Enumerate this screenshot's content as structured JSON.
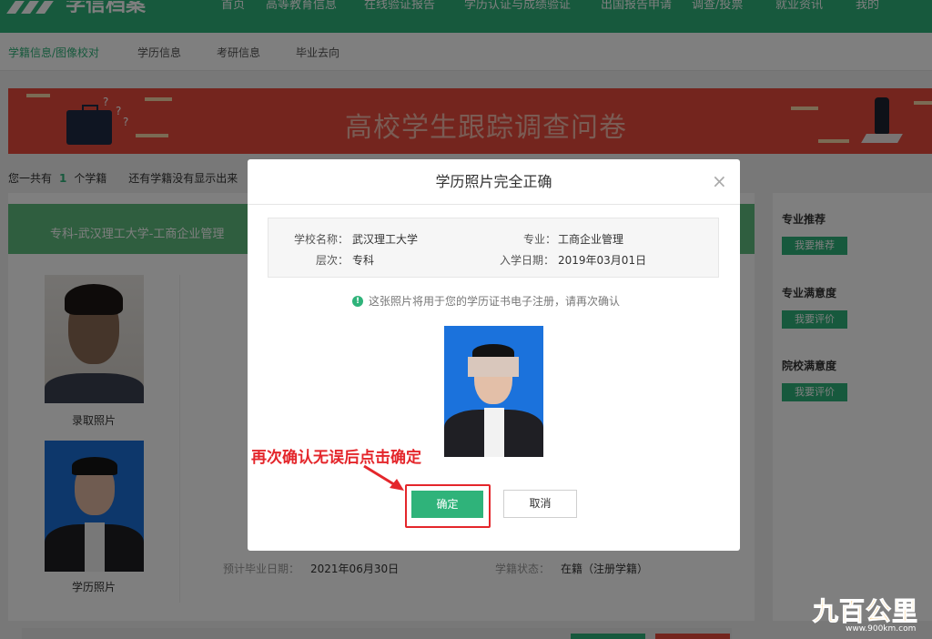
{
  "nav": {
    "logo_text": "学信档案",
    "items": [
      "首页",
      "高等教育信息",
      "在线验证报告",
      "学历认证与成绩验证",
      "出国报告申请",
      "调查/投票",
      "就业资讯",
      "我的"
    ]
  },
  "subnav": {
    "items": [
      "学籍信息/图像校对",
      "学历信息",
      "考研信息",
      "毕业去向"
    ]
  },
  "banner": {
    "title": "高校学生跟踪调查问卷"
  },
  "record": {
    "prefix": "您一共有",
    "count": "1",
    "suffix": "个学籍",
    "missing": "还有学籍没有显示出来"
  },
  "card": {
    "header": "专科-武汉理工大学-工商企业管理",
    "photo1_caption": "录取照片",
    "photo2_caption": "学历照片",
    "expected_grad_label": "预计毕业日期：",
    "expected_grad_value": "2021年06月30日",
    "status_label": "学籍状态：",
    "status_value": "在籍（注册学籍）"
  },
  "right_panel": {
    "sections": [
      {
        "label": "专业推荐",
        "button": "我要推荐"
      },
      {
        "label": "专业满意度",
        "button": "我要评价"
      },
      {
        "label": "院校满意度",
        "button": "我要评价"
      }
    ]
  },
  "modal": {
    "title": "学历照片完全正确",
    "close": "×",
    "school_label": "学校名称：",
    "school_value": "武汉理工大学",
    "major_label": "专业：",
    "major_value": "工商企业管理",
    "level_label": "层次：",
    "level_value": "专科",
    "enroll_label": "入学日期：",
    "enroll_value": "2019年03月01日",
    "tip": "这张照片将用于您的学历证书电子注册，请再次确认",
    "tip_icon": "!",
    "ok": "确定",
    "cancel": "取消"
  },
  "annotation": {
    "text": "再次确认无误后点击确定",
    "color": "#e4262b"
  },
  "watermark": {
    "text": "九百公里",
    "url": "www.900km.com"
  },
  "colors": {
    "brand_green": "#2fb37a",
    "banner_red": "#e84b3c",
    "annotation_red": "#e4262b"
  }
}
